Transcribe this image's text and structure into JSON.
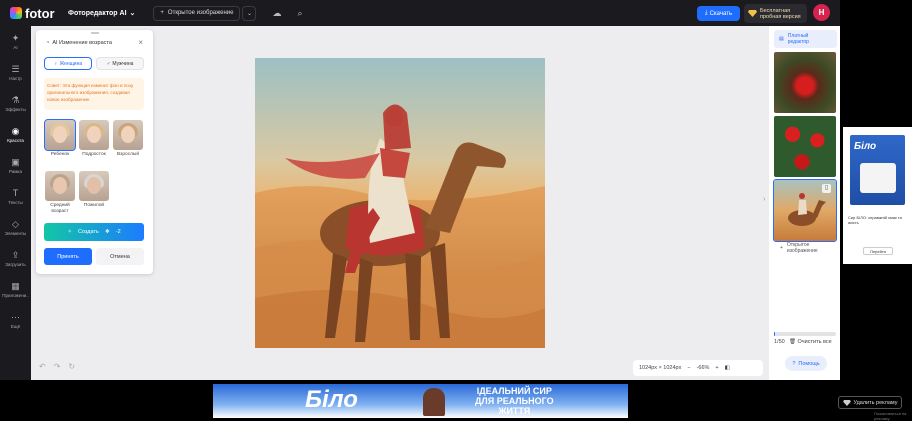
{
  "topbar": {
    "logo_text": "fotor",
    "editor_title": "Фоторедактор AI",
    "open_image": "Открытое изображение",
    "download": "Скачать",
    "trial_line1": "Бесплатная",
    "trial_line2": "пробная версия",
    "avatar_letter": "H",
    "accent": "#1f6dff"
  },
  "leftnav": [
    {
      "label": "AI",
      "icon": "sparkle-icon"
    },
    {
      "label": "Настр",
      "icon": "sliders-icon"
    },
    {
      "label": "Эффекты",
      "icon": "flask-icon"
    },
    {
      "label": "Красота",
      "icon": "eye-icon",
      "active": true
    },
    {
      "label": "Рамка",
      "icon": "frame-icon"
    },
    {
      "label": "Тексты",
      "icon": "text-icon"
    },
    {
      "label": "Элементы",
      "icon": "shapes-icon"
    },
    {
      "label": "Загрузить",
      "icon": "upload-icon"
    },
    {
      "label": "Приложени..",
      "icon": "apps-icon"
    },
    {
      "label": "Ещё",
      "icon": "more-icon"
    }
  ],
  "panel": {
    "title": "AI Изменение возраста",
    "female": "Женщина",
    "male": "Мужчина",
    "tip": "Совет: Эта функция изменит фон и позу оригинального изображения, создавая новое изображение.",
    "ages": [
      {
        "label": "Ребенок"
      },
      {
        "label": "Подросток"
      },
      {
        "label": "Взрослый"
      },
      {
        "label": "Средний возраст"
      },
      {
        "label": "Пожилой"
      }
    ],
    "create": "Создать",
    "credits": "-2",
    "apply": "Принять",
    "cancel": "Отмена"
  },
  "zoom": {
    "dimensions": "1024px × 1024px",
    "level": "-66%"
  },
  "rightpanel": {
    "paid_line1": "Платный",
    "paid_line2": "редактор",
    "add_line1": "Открытое",
    "add_line2": "изображение",
    "history_count": "1/50",
    "clear_all": "Очистить все",
    "help": "Помощь"
  },
  "ads": {
    "side_brand": "Біло",
    "side_caption": "Сир БІЛО: справжній смак та якість",
    "side_button": "Перейти",
    "bottom_brand": "Біло",
    "bottom_line1": "ІДЕАЛЬНИЙ СИР",
    "bottom_line2": "ДЛЯ РЕАЛЬНОГО",
    "bottom_line3": "ЖИТТЯ",
    "remove_ad": "Удалить рекламу",
    "report_ad": "Пожаловаться на рекламу"
  }
}
